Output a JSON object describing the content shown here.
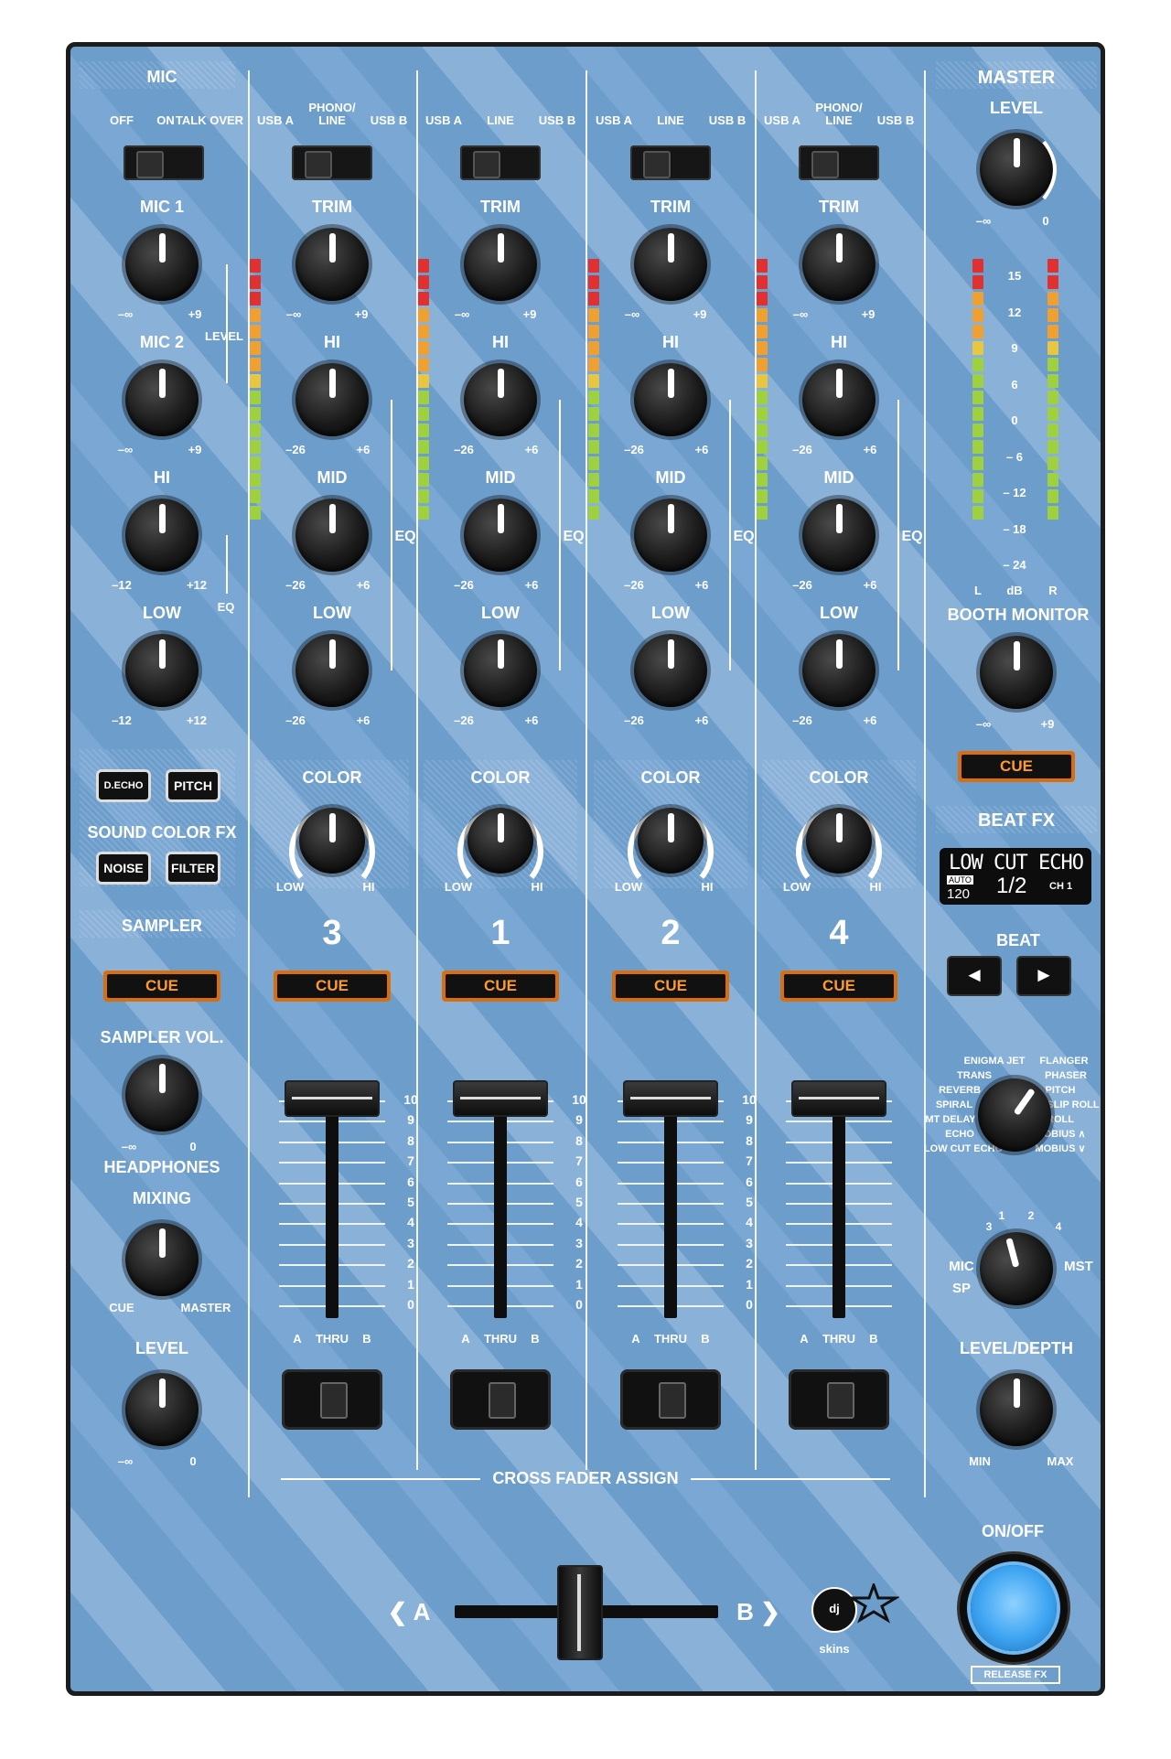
{
  "mic": {
    "title": "MIC",
    "switch_labels": [
      "OFF",
      "ON",
      "TALK OVER"
    ],
    "mic1": "MIC 1",
    "mic2": "MIC 2",
    "level": "LEVEL",
    "hi": "HI",
    "low": "LOW",
    "eq": "EQ",
    "range_mic": [
      "–∞",
      "+9"
    ],
    "range_eq": [
      "–12",
      "+12"
    ]
  },
  "sound_color_fx": {
    "title": "SOUND COLOR FX",
    "buttons": [
      "D.ECHO",
      "PITCH",
      "NOISE",
      "FILTER"
    ]
  },
  "sampler": {
    "title": "SAMPLER",
    "cue": "CUE",
    "vol_label": "SAMPLER VOL.",
    "vol_range": [
      "–∞",
      "0"
    ]
  },
  "headphones": {
    "title": "HEADPHONES",
    "mixing": "MIXING",
    "mixing_range": [
      "CUE",
      "MASTER"
    ],
    "level": "LEVEL",
    "level_range": [
      "–∞",
      "0"
    ]
  },
  "channels": [
    {
      "number": "3",
      "input": [
        "USB A",
        "PHONO/",
        "LINE",
        "USB B"
      ]
    },
    {
      "number": "1",
      "input": [
        "USB A",
        "",
        "LINE",
        "USB B"
      ]
    },
    {
      "number": "2",
      "input": [
        "USB A",
        "",
        "LINE",
        "USB B"
      ]
    },
    {
      "number": "4",
      "input": [
        "USB A",
        "PHONO/",
        "LINE",
        "USB B"
      ]
    }
  ],
  "channel_labels": {
    "trim": "TRIM",
    "trim_range": [
      "–∞",
      "+9"
    ],
    "hi": "HI",
    "mid": "MID",
    "low": "LOW",
    "eq": "EQ",
    "eq_range": [
      "–26",
      "+6"
    ],
    "color": "COLOR",
    "color_range": [
      "LOW",
      "HI"
    ],
    "cue": "CUE",
    "assign": [
      "A",
      "THRU",
      "B"
    ],
    "fader_scale": [
      "10",
      "9",
      "8",
      "7",
      "6",
      "5",
      "4",
      "3",
      "2",
      "1",
      "0"
    ]
  },
  "crossfader": {
    "assign_label": "CROSS FADER ASSIGN",
    "left": "❮ A",
    "right": "B ❯"
  },
  "master": {
    "title": "MASTER",
    "level": "LEVEL",
    "range": [
      "–∞",
      "0"
    ],
    "meter_scale": [
      "15",
      "12",
      "9",
      "6",
      "0",
      "– 6",
      "– 12",
      "– 18",
      "– 24"
    ],
    "meter_labels": [
      "L",
      "dB",
      "R"
    ]
  },
  "booth": {
    "title": "BOOTH MONITOR",
    "range": [
      "–∞",
      "+9"
    ],
    "cue": "CUE"
  },
  "beat_fx": {
    "title": "BEAT FX",
    "display_effect": "LOW CUT ECHO",
    "display_auto": "AUTO",
    "display_bpm": "120",
    "display_beat": "1/2",
    "display_channel": "CH 1",
    "beat_label": "BEAT",
    "beat_left": "◄",
    "beat_right": "►",
    "effects_left": [
      "ENIGMA JET",
      "TRANS",
      "REVERB",
      "SPIRAL",
      "MT DELAY",
      "ECHO",
      "LOW CUT ECHO"
    ],
    "effects_right": [
      "FLANGER",
      "PHASER",
      "PITCH",
      "SLIP ROLL",
      "ROLL",
      "MOBIUS ∧",
      "MOBIUS ∨"
    ],
    "channel_select": [
      "MIC",
      "SP",
      "3",
      "1",
      "2",
      "4",
      "MST"
    ],
    "level_depth": "LEVEL/DEPTH",
    "level_range": [
      "MIN",
      "MAX"
    ],
    "on_off": "ON/OFF",
    "release_fx": "RELEASE FX"
  },
  "brand": "dj skins"
}
